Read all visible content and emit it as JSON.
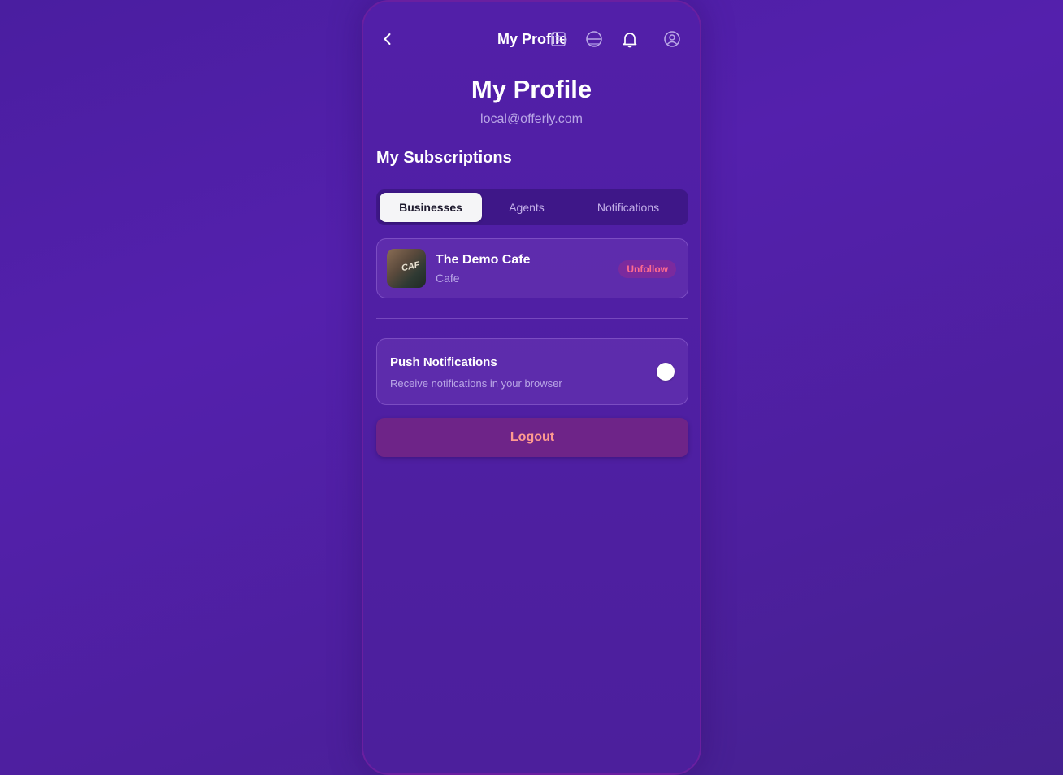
{
  "topbar": {
    "title": "My Profile"
  },
  "header": {
    "title": "My Profile",
    "email": "local@offerly.com"
  },
  "subscriptions": {
    "section_title": "My Subscriptions",
    "tabs": [
      {
        "label": "Businesses",
        "active": true
      },
      {
        "label": "Agents",
        "active": false
      },
      {
        "label": "Notifications",
        "active": false
      }
    ],
    "items": [
      {
        "name": "The Demo Cafe",
        "category": "Cafe",
        "action_label": "Unfollow",
        "thumb_text": "CAF"
      }
    ]
  },
  "push": {
    "title": "Push Notifications",
    "description": "Receive notifications in your browser",
    "enabled": false
  },
  "logout_label": "Logout",
  "icons": {
    "back": "chevron-left-icon",
    "translate": "translate-icon",
    "theme": "globe-icon",
    "notifications": "bell-icon",
    "profile": "user-circle-icon"
  },
  "colors": {
    "background": "#5420ad",
    "accent_unfollow": "#ff6b8f",
    "logout_bg": "#6e2488",
    "logout_text": "#ff9a8f"
  }
}
